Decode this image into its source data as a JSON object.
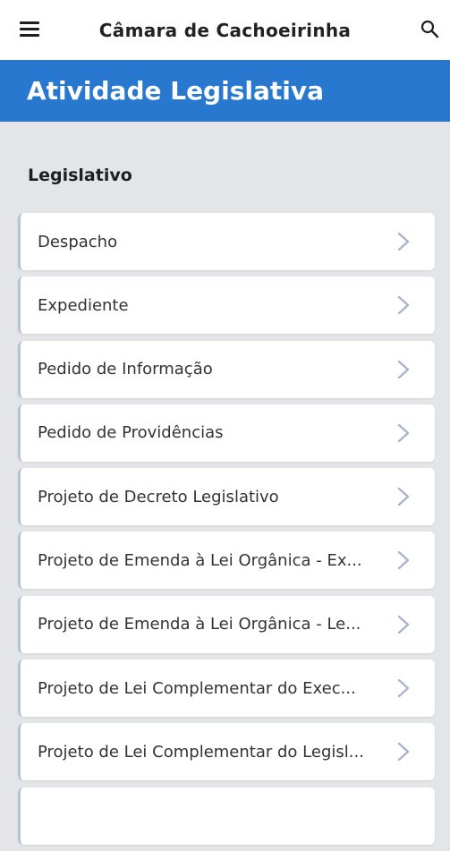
{
  "header": {
    "title": "Câmara de Cachoeirinha",
    "menu_icon": "menu-icon",
    "search_icon": "search-icon"
  },
  "hero": {
    "title": "Atividade Legislativa",
    "color": "#2878d0"
  },
  "section": {
    "title": "Legislativo"
  },
  "items": [
    {
      "label": "Despacho"
    },
    {
      "label": "Expediente"
    },
    {
      "label": "Pedido de Informação"
    },
    {
      "label": "Pedido de Providências"
    },
    {
      "label": "Projeto de Decreto Legislativo"
    },
    {
      "label": "Projeto de Emenda à Lei Orgânica - Ex..."
    },
    {
      "label": "Projeto de Emenda à Lei Orgânica - Le..."
    },
    {
      "label": "Projeto de Lei Complementar do Exec..."
    },
    {
      "label": "Projeto de Lei Complementar do Legisl..."
    },
    {
      "label": ""
    }
  ],
  "chevron_icon": "chevron-right-icon"
}
